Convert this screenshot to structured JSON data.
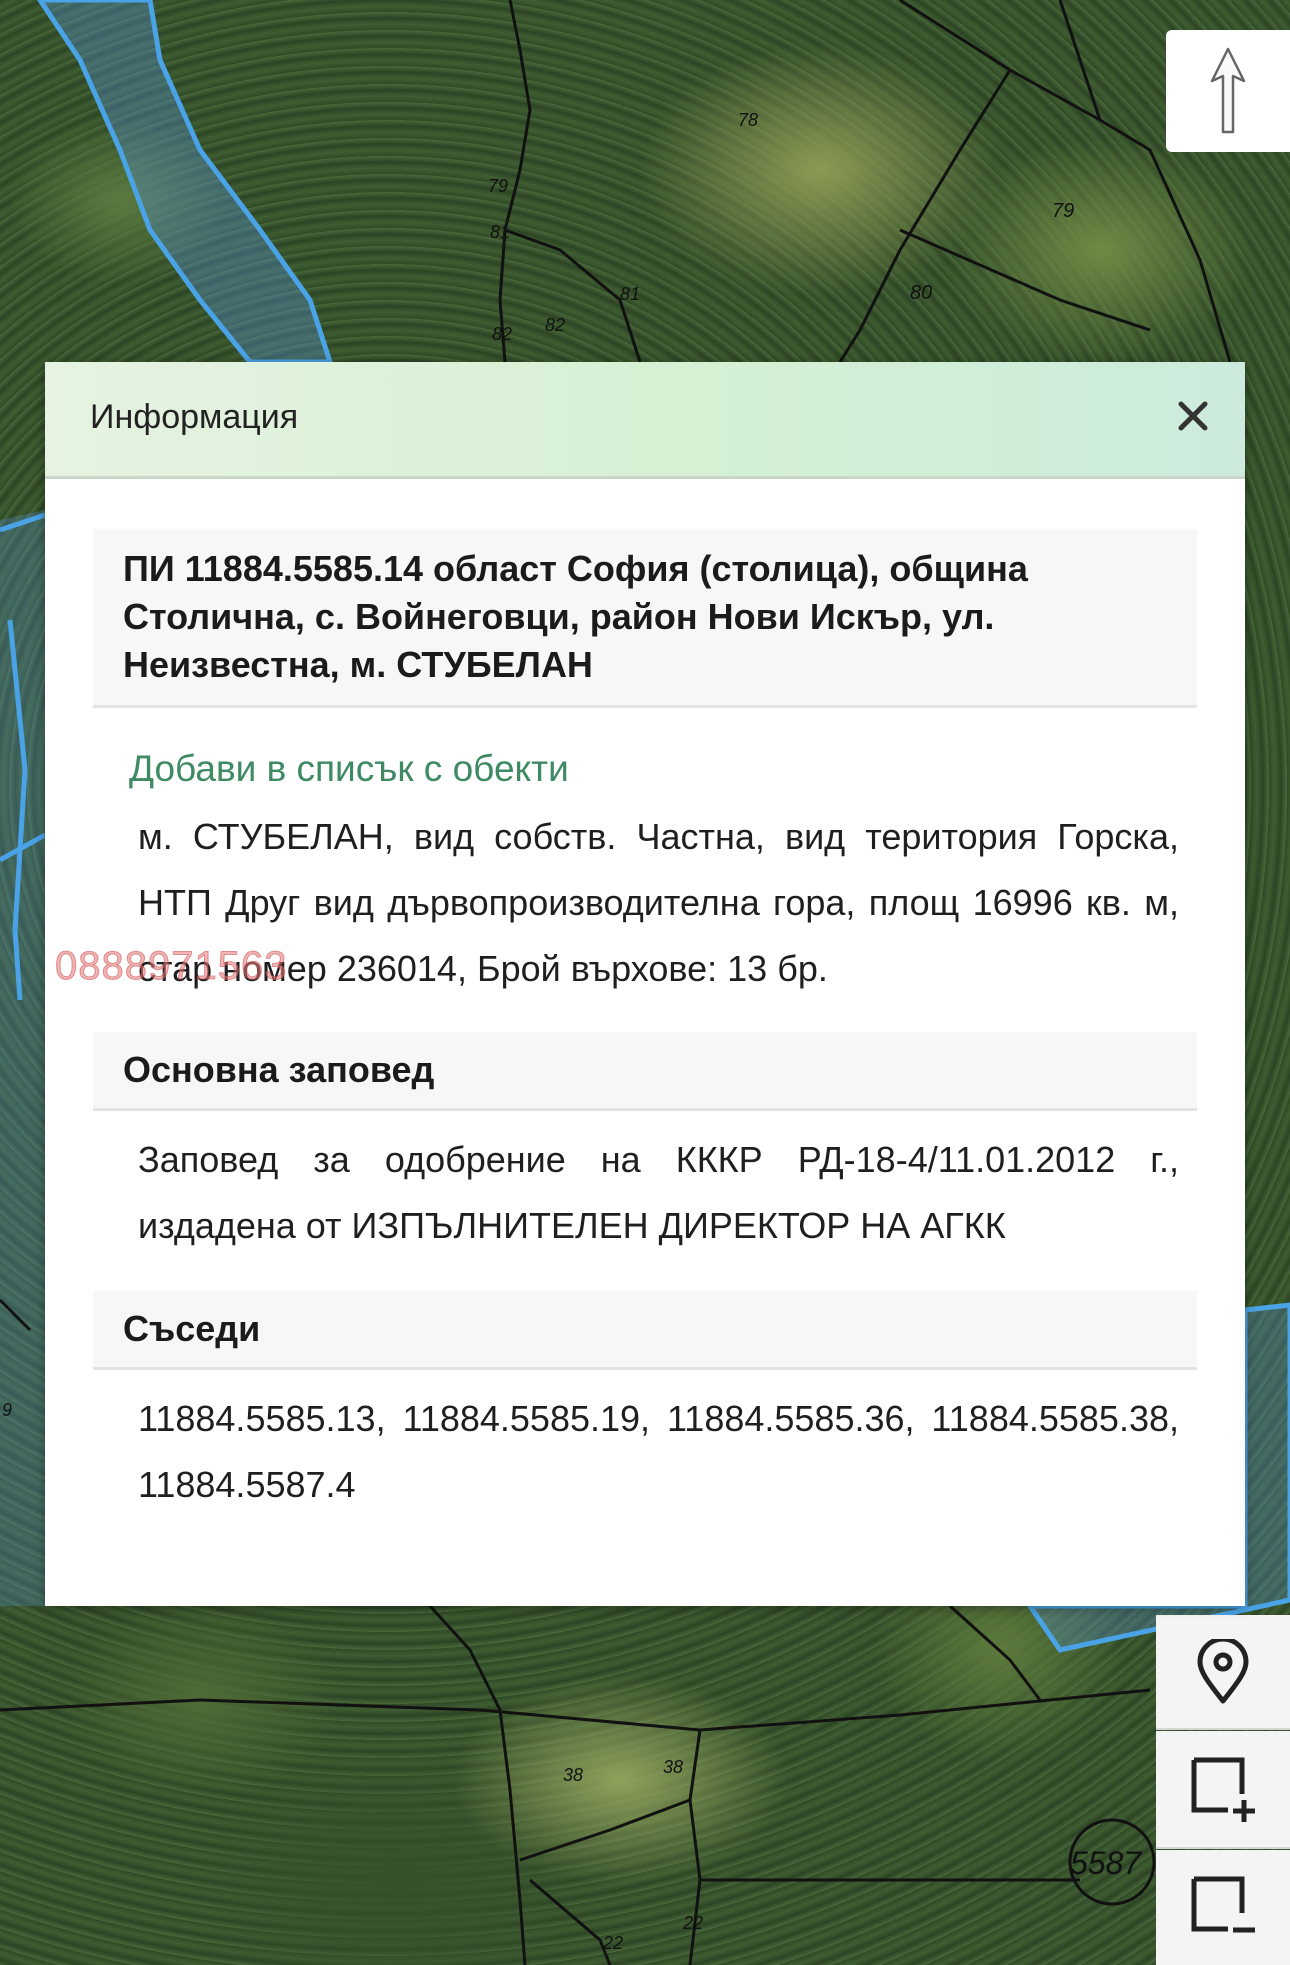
{
  "map": {
    "parcel_labels": [
      "78",
      "79",
      "80",
      "81",
      "81",
      "82",
      "82",
      "79",
      "38",
      "38",
      "22",
      "22",
      "9"
    ],
    "district_label": "5587"
  },
  "controls": {
    "north_icon": "north-arrow-icon",
    "locate_icon": "map-pin-icon",
    "zoom_in_icon": "select-area-plus-icon",
    "zoom_out_icon": "select-area-minus-icon"
  },
  "watermark": "0888971563",
  "dialog": {
    "title": "Информация",
    "close_icon": "close-icon",
    "parcel_title": "ПИ 11884.5585.14 област София (столица), община Столична, с. Войнеговци, район Нови Искър, ул. Неизвестна, м. СТУБЕЛАН",
    "add_to_list": "Добави в списък с обекти",
    "description": "м. СТУБЕЛАН, вид собств. Частна, вид територия Горска, НТП Друг вид дървопроизводителна гора, площ 16996 кв. м, стар номер 236014, Брой върхове: 13 бр.",
    "order": {
      "heading": "Основна заповед",
      "text": "Заповед за одобрение на КККР РД-18-4/11.01.2012 г., издадена от ИЗПЪЛНИТЕЛЕН ДИРЕКТОР НА АГКК"
    },
    "neighbours": {
      "heading": "Съседи",
      "text": "11884.5585.13, 11884.5585.19, 11884.5585.36, 11884.5585.38, 11884.5587.4"
    }
  },
  "colors": {
    "link": "#3d8a63",
    "boundary_blue": "#4aa3e6",
    "header_green": "#d5f0d3"
  }
}
